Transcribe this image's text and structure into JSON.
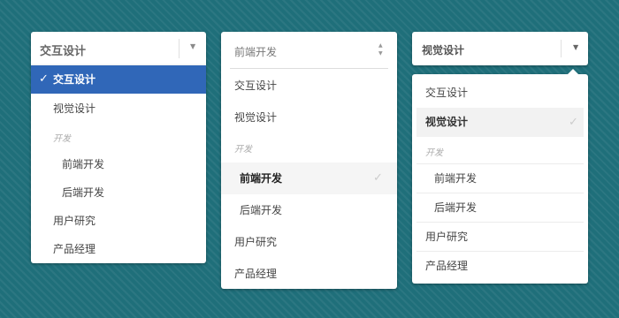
{
  "dropdown1": {
    "selected_value": "交互设计",
    "arrow_icon": "triangle-down",
    "items": [
      {
        "label": "交互设计",
        "selected": true
      },
      {
        "label": "视觉设计"
      },
      {
        "group": "开发"
      },
      {
        "label": "前端开发",
        "indent": true
      },
      {
        "label": "后端开发",
        "indent": true
      },
      {
        "label": "用户研究"
      },
      {
        "label": "产品经理"
      }
    ],
    "check_glyph": "✓",
    "accent_color": "#3067b8"
  },
  "dropdown2": {
    "placeholder": "前端开发",
    "spinner_icon": "up-down-arrows",
    "items": [
      {
        "label": "交互设计"
      },
      {
        "label": "视觉设计"
      },
      {
        "group": "开发"
      },
      {
        "label": "前端开发",
        "indent": true,
        "selected": true
      },
      {
        "label": "后端开发",
        "indent": true
      },
      {
        "label": "用户研究"
      },
      {
        "label": "产品经理"
      }
    ],
    "check_glyph": "✓"
  },
  "dropdown3": {
    "selected_value": "视觉设计",
    "arrow_icon": "triangle-down",
    "items": [
      {
        "label": "交互设计"
      },
      {
        "label": "视觉设计",
        "selected": true
      },
      {
        "group": "开发"
      },
      {
        "label": "前端开发",
        "indent": true
      },
      {
        "label": "后端开发",
        "indent": true
      },
      {
        "label": "用户研究"
      },
      {
        "label": "产品经理"
      }
    ],
    "check_glyph": "✓"
  },
  "background_color": "#1f6f7a"
}
